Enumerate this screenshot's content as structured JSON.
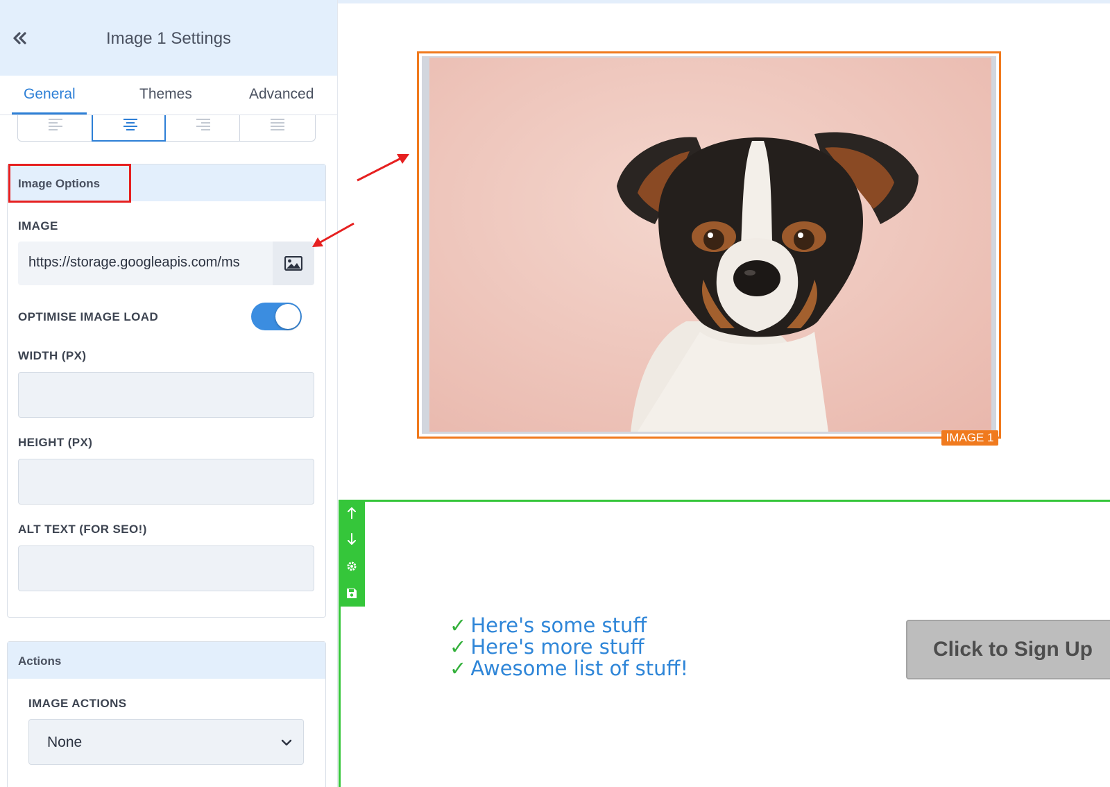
{
  "sidebar": {
    "title": "Image 1 Settings",
    "tabs": [
      {
        "label": "General",
        "active": true
      },
      {
        "label": "Themes",
        "active": false
      },
      {
        "label": "Advanced",
        "active": false
      }
    ],
    "alignment": {
      "options": [
        "left",
        "center",
        "right",
        "justify"
      ],
      "selected": "center"
    },
    "image_options": {
      "heading": "Image Options",
      "image_label": "IMAGE",
      "image_url": "https://storage.googleapis.com/ms",
      "optimise_label": "OPTIMISE IMAGE LOAD",
      "optimise_enabled": true,
      "width_label": "WIDTH (PX)",
      "width_value": "",
      "height_label": "HEIGHT (PX)",
      "height_value": "",
      "alt_label": "ALT TEXT (FOR SEO!)",
      "alt_value": ""
    },
    "actions": {
      "heading": "Actions",
      "image_actions_label": "IMAGE ACTIONS",
      "image_actions_value": "None"
    }
  },
  "canvas": {
    "image_badge": "IMAGE 1",
    "bullets": [
      {
        "check": "✓",
        "text": "Here's some stuff"
      },
      {
        "check": "✓",
        "text": "Here's more stuff"
      },
      {
        "check": "✓",
        "text": "Awesome list of stuff!"
      }
    ],
    "cta_label": "Click to Sign Up",
    "section_tools": [
      "arrow-up-icon",
      "arrow-down-icon",
      "gear-icon",
      "save-icon"
    ]
  },
  "colors": {
    "accent_blue": "#2d7fd6",
    "selection_orange": "#f07a1e",
    "section_green": "#35c63a",
    "annotation_red": "#e62020",
    "header_bg": "#e3effc"
  }
}
